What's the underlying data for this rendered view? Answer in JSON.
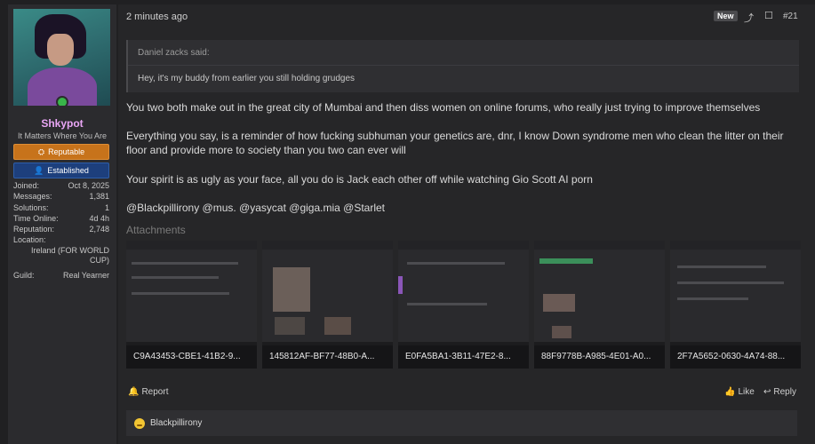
{
  "sidebar": {
    "username": "Shkypot",
    "user_title": "It Matters Where You Are",
    "badges": {
      "reputable": "Reputable",
      "established": "Established"
    },
    "stats": [
      {
        "label": "Joined:",
        "value": "Oct 8, 2025"
      },
      {
        "label": "Messages:",
        "value": "1,381"
      },
      {
        "label": "Solutions:",
        "value": "1"
      },
      {
        "label": "Time Online:",
        "value": "4d 4h"
      },
      {
        "label": "Reputation:",
        "value": "2,748"
      }
    ],
    "location_label": "Location:",
    "location_value": "Ireland (FOR WORLD CUP)",
    "guild_label": "Guild:",
    "guild_value": "Real Yearner"
  },
  "post": {
    "time": "2 minutes ago",
    "new_badge": "New",
    "post_number": "#21",
    "quote": {
      "author": "Daniel zacks said:",
      "text": "Hey, it's my buddy from earlier you still holding grudges"
    },
    "paragraphs": [
      "You two both make out in the great city of Mumbai and then diss women on online forums, who really just trying to improve themselves",
      "Everything you say, is a reminder of how fucking subhuman your genetics are, dnr, I know Down syndrome men who clean the litter on their floor and provide more to society than you two can ever will",
      "Your spirit is as ugly as your face, all you do is Jack each other off while watching Gio Scott AI porn",
      "@Blackpillirony @mus. @yasycat @giga.mia @Starlet"
    ],
    "attachments_title": "Attachments",
    "attachments": [
      "C9A43453-CBE1-41B2-9...",
      "145812AF-BF77-48B0-A...",
      "E0FA5BA1-3B11-47E2-8...",
      "88F9778B-A985-4E01-A0...",
      "2F7A5652-0630-4A74-88..."
    ],
    "actions": {
      "report": "Report",
      "like": "Like",
      "reply": "Reply"
    },
    "reactions_user": "Blackpillirony"
  }
}
